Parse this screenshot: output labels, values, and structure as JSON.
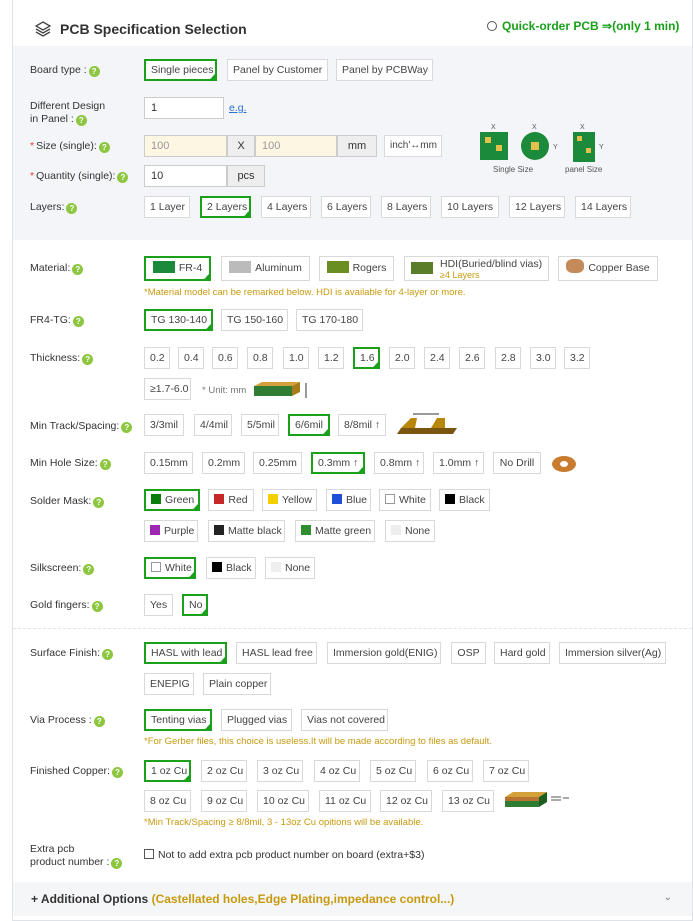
{
  "header": {
    "title": "PCB Specification Selection",
    "quick_order": "Quick-order PCB ⇒(only 1 min)"
  },
  "board_type": {
    "label": "Board type :",
    "options": [
      "Single pieces",
      "Panel by Customer",
      "Panel by PCBWay"
    ],
    "selected": "Single pieces"
  },
  "design": {
    "label_line1": "Different Design",
    "label_line2": "in Panel :",
    "value": "1",
    "link": "e.g."
  },
  "size": {
    "label": "Size (single):",
    "width_placeholder": "100",
    "x": "X",
    "height_placeholder": "100",
    "unit": "mm",
    "switch": "inch'↔mm",
    "single_caption": "Single Size",
    "panel_caption": "panel Size"
  },
  "quantity": {
    "label": "Quantity (single):",
    "value": "10",
    "unit": "pcs"
  },
  "layers": {
    "label": "Layers:",
    "options": [
      "1 Layer",
      "2 Layers",
      "4 Layers",
      "6 Layers",
      "8 Layers",
      "10 Layers",
      "12 Layers",
      "14 Layers"
    ],
    "selected": "2 Layers"
  },
  "material": {
    "label": "Material:",
    "options": [
      "FR-4",
      "Aluminum",
      "Rogers",
      "HDI(Buried/blind vias)",
      "Copper Base"
    ],
    "hdi_sub": "≥4 Layers",
    "selected": "FR-4",
    "note": "*Material model can be remarked below. HDI is available for 4-layer or more."
  },
  "fr4tg": {
    "label": "FR4-TG:",
    "options": [
      "TG 130-140",
      "TG 150-160",
      "TG 170-180"
    ],
    "selected": "TG 130-140"
  },
  "thickness": {
    "label": "Thickness:",
    "options": [
      "0.2",
      "0.4",
      "0.6",
      "0.8",
      "1.0",
      "1.2",
      "1.6",
      "2.0",
      "2.4",
      "2.6",
      "2.8",
      "3.0",
      "3.2"
    ],
    "extra": "≥1.7-6.0",
    "unit_note": "* Unit: mm",
    "selected": "1.6"
  },
  "track": {
    "label": "Min Track/Spacing:",
    "options": [
      "3/3mil",
      "4/4mil",
      "5/5mil",
      "6/6mil",
      "8/8mil ↑"
    ],
    "selected": "6/6mil"
  },
  "hole": {
    "label": "Min Hole Size:",
    "options": [
      "0.15mm",
      "0.2mm",
      "0.25mm",
      "0.3mm ↑",
      "0.8mm ↑",
      "1.0mm ↑",
      "No Drill"
    ],
    "selected": "0.3mm ↑"
  },
  "mask": {
    "label": "Solder Mask:",
    "options": [
      {
        "name": "Green",
        "color": "#0a7d0a"
      },
      {
        "name": "Red",
        "color": "#c62828"
      },
      {
        "name": "Yellow",
        "color": "#f5d000"
      },
      {
        "name": "Blue",
        "color": "#1e4fd6"
      },
      {
        "name": "White",
        "color": "#ffffff"
      },
      {
        "name": "Black",
        "color": "#000000"
      },
      {
        "name": "Purple",
        "color": "#9c27b0"
      },
      {
        "name": "Matte black",
        "color": "#222222"
      },
      {
        "name": "Matte green",
        "color": "#2f8f2f"
      },
      {
        "name": "None",
        "color": "#eeeeee"
      }
    ],
    "selected": "Green"
  },
  "silk": {
    "label": "Silkscreen:",
    "options": [
      {
        "name": "White",
        "color": "#ffffff"
      },
      {
        "name": "Black",
        "color": "#000000"
      },
      {
        "name": "None",
        "color": "#eeeeee"
      }
    ],
    "selected": "White"
  },
  "gold": {
    "label": "Gold fingers:",
    "options": [
      "Yes",
      "No"
    ],
    "selected": "No"
  },
  "surface": {
    "label": "Surface Finish:",
    "options": [
      "HASL with lead",
      "HASL lead free",
      "Immersion gold(ENIG)",
      "OSP",
      "Hard gold",
      "Immersion silver(Ag)",
      "ENEPIG",
      "Plain copper"
    ],
    "selected": "HASL with lead"
  },
  "via": {
    "label": "Via Process :",
    "options": [
      "Tenting vias",
      "Plugged vias",
      "Vias not covered"
    ],
    "selected": "Tenting vias",
    "note": "*For Gerber files, this choice is useless.It will be made according to files as default."
  },
  "copper": {
    "label": "Finished Copper:",
    "options": [
      "1 oz Cu",
      "2 oz Cu",
      "3 oz Cu",
      "4 oz Cu",
      "5 oz Cu",
      "6 oz Cu",
      "7 oz Cu",
      "8 oz Cu",
      "9 oz Cu",
      "10 oz Cu",
      "11 oz Cu",
      "12 oz Cu",
      "13 oz Cu"
    ],
    "selected": "1 oz Cu",
    "note": "*Min Track/Spacing ≥ 8/8mil, 3 - 13oz Cu opitions will be available."
  },
  "extra": {
    "label_line1": "Extra pcb",
    "label_line2": "product number :",
    "checkbox": "Not to add extra pcb product number on board (extra+$3)"
  },
  "additional": {
    "plus": "+",
    "title": "Additional Options",
    "sub": "(Castellated holes,Edge Plating,impedance control...)"
  }
}
